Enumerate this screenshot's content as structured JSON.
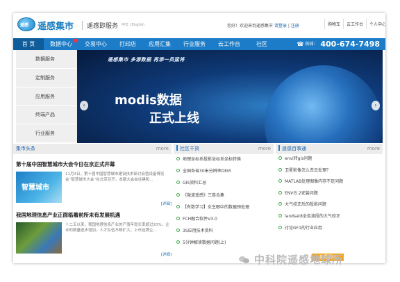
{
  "header": {
    "logo_badge": "遥感",
    "logo_text": "遥感集市",
    "slogan": "遥感即服务",
    "lang": "中文 | English",
    "welcome": "您好！欢迎来到遥感集市",
    "login": "请登录",
    "register": "注册",
    "cart": "购物车",
    "cloud": "云工作台",
    "user_center": "个人中心"
  },
  "nav": {
    "items": [
      "首 页",
      "数据中心",
      "交易中心",
      "打印店",
      "应用汇集",
      "行业服务",
      "云工作台",
      "社区"
    ],
    "hotline_label": "热线：",
    "hotline_number": "400-674-7498"
  },
  "sidebar": {
    "items": [
      "数据服务",
      "定制服务",
      "应用服务",
      "终端产品",
      "行业服务"
    ]
  },
  "banner": {
    "slogan": "遥感集市 多源数据 再添一员猛将",
    "title": "modis数据",
    "subtitle": "正式上线"
  },
  "news": {
    "header": "集市头条",
    "more": "more",
    "items": [
      {
        "title": "第十届中国智慧城市大会今日在京正式开幕",
        "thumb": "智慧城市",
        "text": "11月3日，第十届中国智慧城市建设技术研讨会暨设备博览会“智慧城市大会”在北京召开，本届大会由住建和...",
        "detail": "[详细]"
      },
      {
        "title": "我国地理信息产业正面临着前所未有发展机遇",
        "thumb": "",
        "text": "十二五以来，我国地理信息产业的产值年增长率超过20%，企业的数量逐步增加，人才队伍不断扩大，上市挂牌企...",
        "detail": "[详细]"
      }
    ]
  },
  "community": {
    "header": "社区干货",
    "more": "more",
    "items": [
      "地理坐标系投影坐标系坐标转换",
      "全国各省30米分辨率DEM",
      "GIS资料汇总",
      "《微波遥感》三卷合集",
      "【有数学习】女生眼中的数据预处理",
      "FCH融合软件V3.0",
      "3S应用技术资料",
      "5分钟解读数据问题(上)"
    ]
  },
  "qa": {
    "header": "遥感百事通",
    "more": "more",
    "items": [
      "envi转gis问题",
      "卫星影像怎么去云处理？",
      "MATLAB处理图像内存不足问题",
      "ENVI5.2安装问题",
      "大气校正后的投影问题",
      "landsat8全色波段的大气校正",
      "讨论GF1的行业应用"
    ],
    "ask_button": "我要提问"
  },
  "watermark": "中科院遥感地球所"
}
